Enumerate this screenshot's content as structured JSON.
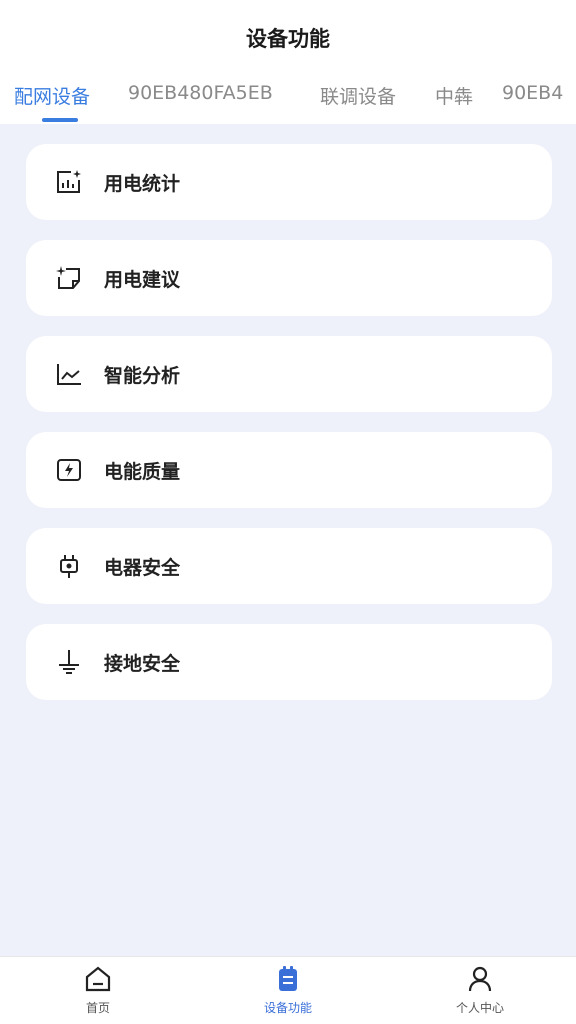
{
  "header": {
    "title": "设备功能"
  },
  "tabs": [
    {
      "label": "配网设备",
      "active": true
    },
    {
      "label": "90EB480FA5EB",
      "active": false
    },
    {
      "label": "联调设备",
      "active": false
    },
    {
      "label": "中犇",
      "active": false
    },
    {
      "label": "90EB4",
      "active": false
    }
  ],
  "features": [
    {
      "label": "用电统计",
      "icon": "bar-chart-sparkle-icon"
    },
    {
      "label": "用电建议",
      "icon": "note-sparkle-icon"
    },
    {
      "label": "智能分析",
      "icon": "line-chart-icon"
    },
    {
      "label": "电能质量",
      "icon": "lightning-box-icon"
    },
    {
      "label": "电器安全",
      "icon": "plug-icon"
    },
    {
      "label": "接地安全",
      "icon": "ground-icon"
    }
  ],
  "bottom_nav": [
    {
      "label": "首页",
      "icon": "home-icon",
      "active": false
    },
    {
      "label": "设备功能",
      "icon": "clipboard-icon",
      "active": true
    },
    {
      "label": "个人中心",
      "icon": "user-icon",
      "active": false
    }
  ],
  "colors": {
    "accent": "#3a7de0",
    "background": "#eef0fa",
    "card": "#ffffff"
  }
}
